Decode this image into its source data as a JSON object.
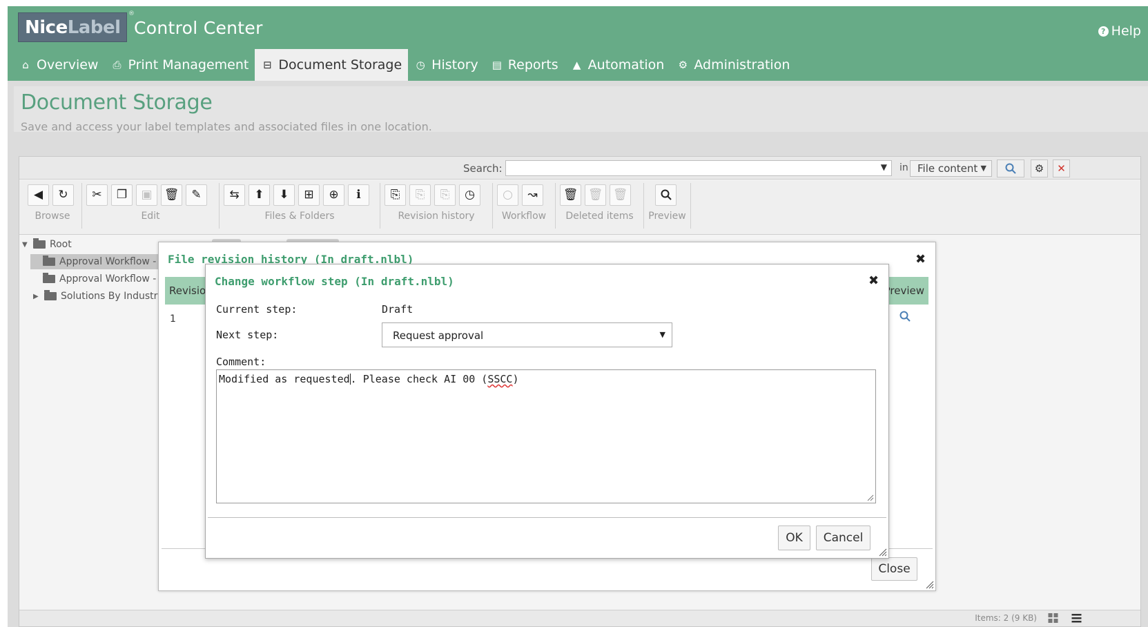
{
  "app": {
    "logo_part1": "Nice",
    "logo_part2": "Label",
    "logo_mark": "®",
    "title": "Control Center",
    "help": "Help"
  },
  "nav": [
    {
      "icon": "home-icon",
      "label": "Overview"
    },
    {
      "icon": "printer-icon",
      "label": "Print Management"
    },
    {
      "icon": "storage-icon",
      "label": "Document Storage",
      "active": true
    },
    {
      "icon": "clock-icon",
      "label": "History"
    },
    {
      "icon": "chart-icon",
      "label": "Reports"
    },
    {
      "icon": "automation-icon",
      "label": "Automation"
    },
    {
      "icon": "gears-icon",
      "label": "Administration"
    }
  ],
  "page": {
    "title": "Document Storage",
    "subtitle": "Save and access your label templates and associated files in one location."
  },
  "search": {
    "label": "Search:",
    "value": "",
    "in_label": "in",
    "scope": "File content"
  },
  "toolbar": {
    "groups": [
      "Browse",
      "Edit",
      "Files & Folders",
      "Revision history",
      "Workflow",
      "Deleted items",
      "Preview"
    ]
  },
  "tree": {
    "root": "Root",
    "items": [
      "Approval Workflow -",
      "Approval Workflow -",
      "Solutions By Industry"
    ]
  },
  "status": {
    "items": "Items: 2 (9 KB)"
  },
  "revision_dialog": {
    "title": "File revision history (In draft.nlbl)",
    "col_revision": "Revisio",
    "col_preview": "Preview",
    "row_revision": "1",
    "close": "Close"
  },
  "workflow_dialog": {
    "title": "Change workflow step (In draft.nlbl)",
    "current_step_label": "Current step:",
    "current_step_value": "Draft",
    "next_step_label": "Next step:",
    "next_step_value": "Request approval",
    "comment_label": "Comment:",
    "comment_before_caret": "Modified as requested",
    "comment_after_caret": ". Please check AI 00 (",
    "comment_misspelled": "SSCC",
    "comment_end": ")",
    "ok": "OK",
    "cancel": "Cancel"
  },
  "colors": {
    "brand_green": "#67ab87",
    "title_green": "#3e9d6e",
    "header_green": "#9fcfb3"
  }
}
